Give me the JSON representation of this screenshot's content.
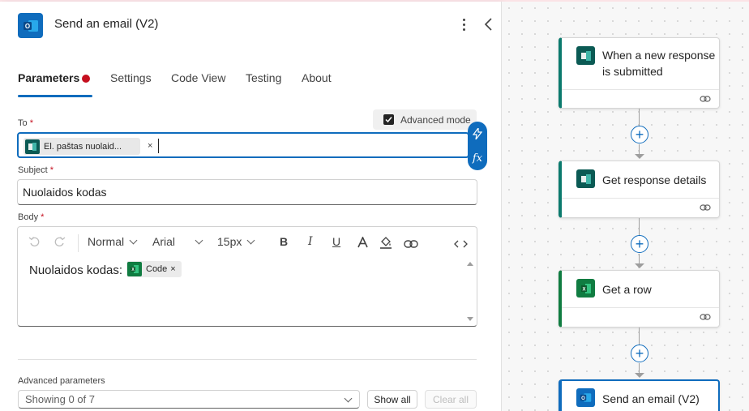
{
  "panel": {
    "title": "Send an email (V2)",
    "tabs": [
      {
        "label": "Parameters",
        "has_error": true
      },
      {
        "label": "Settings"
      },
      {
        "label": "Code View"
      },
      {
        "label": "Testing"
      },
      {
        "label": "About"
      }
    ],
    "advanced_mode_label": "Advanced mode",
    "advanced_mode_checked": true,
    "to": {
      "label": "To",
      "required_mark": "*",
      "token_label": "El. paštas nuolaid...",
      "token_remove": "×"
    },
    "subject": {
      "label": "Subject",
      "required_mark": "*",
      "value": "Nuolaidos kodas"
    },
    "body": {
      "label": "Body",
      "required_mark": "*",
      "toolbar": {
        "style": "Normal",
        "font": "Arial",
        "size": "15px"
      },
      "text": "Nuolaidos kodas:",
      "token_label": "Code",
      "token_remove": "×"
    },
    "advanced_parameters": {
      "label": "Advanced parameters",
      "select_value": "Showing 0 of 7",
      "show_all": "Show all",
      "clear_all": "Clear all"
    }
  },
  "flow": {
    "steps": [
      {
        "title": "When a new response is submitted",
        "icon": "forms-icon",
        "color": "#0b5a54"
      },
      {
        "title": "Get response details",
        "icon": "forms-icon",
        "color": "#0b5a54"
      },
      {
        "title": "Get a row",
        "icon": "excel-icon",
        "color": "#107c41"
      },
      {
        "title": "Send an email (V2)",
        "icon": "outlook-icon",
        "color": "#0f6cbd"
      }
    ]
  },
  "colors": {
    "accent": "#0f6cbd",
    "error": "#c50f1f",
    "forms": "#0b5a54",
    "excel": "#107c41"
  }
}
